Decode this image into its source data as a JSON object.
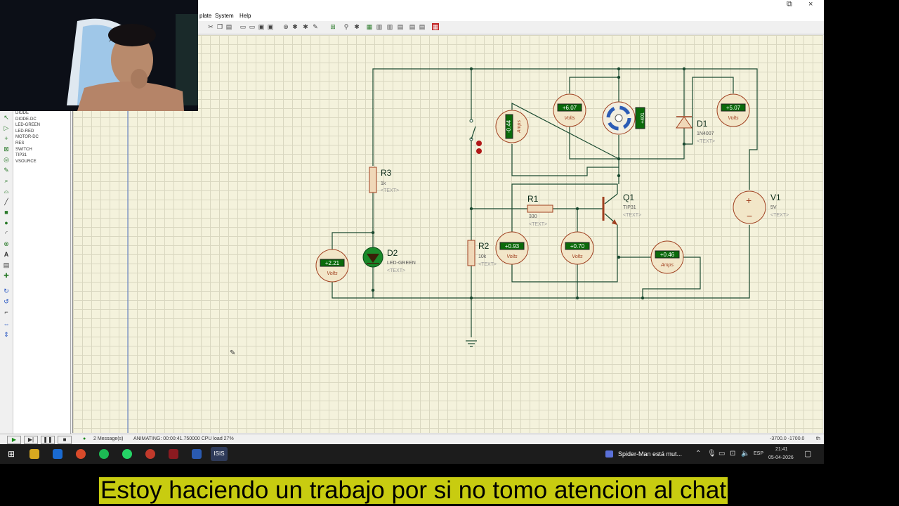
{
  "window": {
    "minimize": "",
    "maximize": "⧉",
    "close": "×"
  },
  "menu": [
    "plate",
    "System",
    "Help"
  ],
  "device_list": [
    "DIODE",
    "DIODE-DC",
    "LED-GREEN",
    "LED-RED",
    "MOTOR-DC",
    "RES",
    "SWITCH",
    "TIP31",
    "VSOURCE"
  ],
  "schematic": {
    "R1": {
      "ref": "R1",
      "value": "330",
      "text": "<TEXT>"
    },
    "R2": {
      "ref": "R2",
      "value": "10k",
      "text": "<TEXT>"
    },
    "R3": {
      "ref": "R3",
      "value": "1k",
      "text": "<TEXT>"
    },
    "D1": {
      "ref": "D1",
      "value": "1N4007",
      "text": "<TEXT>"
    },
    "D2": {
      "ref": "D2",
      "value": "LED-GREEN",
      "text": "<TEXT>"
    },
    "Q1": {
      "ref": "Q1",
      "value": "TIP31",
      "text": "<TEXT>"
    },
    "V1": {
      "ref": "V1",
      "value": "5V",
      "text": "<TEXT>"
    },
    "motor_reading": "+401",
    "meters": {
      "v_led": {
        "value": "+2.21",
        "unit": "Volts"
      },
      "a_switch": {
        "value": "-0.44",
        "unit": "Amps"
      },
      "v_motor": {
        "value": "+6.07",
        "unit": "Volts"
      },
      "v_d1": {
        "value": "+5.07",
        "unit": "Volts"
      },
      "v_r2": {
        "value": "+0.93",
        "unit": "Volts"
      },
      "v_be": {
        "value": "+0.70",
        "unit": "Volts"
      },
      "a_emitter": {
        "value": "+0.46",
        "unit": "Amps"
      }
    }
  },
  "status": {
    "messages": "2 Message(s)",
    "animating": "ANIMATING: 00:00:41.750000 CPU load 27%",
    "coords": "-3700.0  -1700.0",
    "units": "th"
  },
  "taskbar": {
    "spotify_status": "Spider-Man está mut...",
    "language": "ESP",
    "time": "21:41",
    "date": "05-04-2026"
  },
  "caption": "Estoy haciendo un trabajo por si no tomo atencion al chat",
  "colors": {
    "sheet": "#f4f2dc",
    "wire": "#1a4a30",
    "meter_display": "#0a6a0a",
    "caption_bg": "#c8cc10"
  }
}
